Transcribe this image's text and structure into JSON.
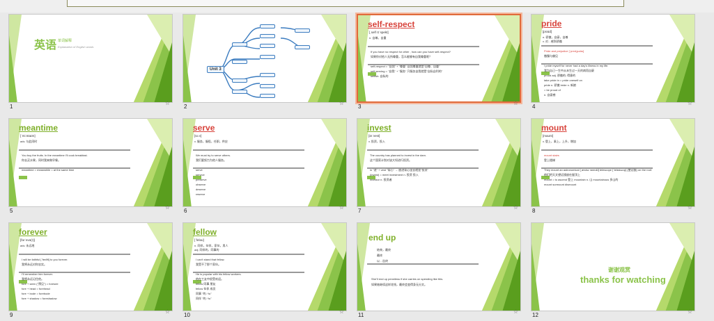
{
  "slides": [
    {
      "num": "1",
      "cover": {
        "title": "英语",
        "sub": "单词解释",
        "sub2": "Explanation of English words"
      }
    },
    {
      "num": "2",
      "mindmap": {
        "center": "Unit 3"
      }
    },
    {
      "num": "3",
      "title": "self-respect",
      "phon": "[ˌself rɪˈspekt]",
      "def": "n. 自尊，自重",
      "lines": [
        "If you have no respect for other , how can you have self-respect?",
        "如果你对他人无所尊重，怎么能够有自我尊重呢？",
        "self-respect  =  \"自我\" + \"尊重\"  自我尊重就是\"自尊、自重\"",
        "self-serving  =  \"自我\" + \"服务\"  只服务自我就是\"自私自利的\"",
        "selfish: 自私的"
      ]
    },
    {
      "num": "4",
      "title": "pride",
      "phon": "[praɪd]",
      "def": "n. 骄傲，自豪，自尊",
      "def2": "v. 对…感到骄傲",
      "lines": [
        "Pride and prejudice [ˈpredʒudɪs]",
        "傲慢与偏见",
        "I pride myself for never had a day's illness in my life.",
        "我为自己一生中从未生过一天的病而自豪",
        "proud   adj. 骄傲的; 得意的",
        "take pride in = pride oneself on",
        "pride   n. 骄傲   bride  n. 新娘",
        "= be proud of",
        "n. 自豪感"
      ]
    },
    {
      "num": "5",
      "title": "meantime",
      "phon": "[ˈmiːntaɪm]",
      "def": "adv. 与此同时",
      "lines": [
        "You buy the fruits. In the meantime I'll cook breakfast.",
        "你去买水果，同时我来做早餐。",
        "meantime = meanwhile = at the same time"
      ]
    },
    {
      "num": "6",
      "title": "serve",
      "phon": "[sɜːv]",
      "def": "v. 服务，服役，任职，供应",
      "lines": [
        "We must try to serve others.",
        "我们要努力为他人服务。",
        "serve",
        "service",
        "preserve",
        "observe",
        "deserve",
        "reserve"
      ]
    },
    {
      "num": "7",
      "title": "invest",
      "phon": "[ɪnˈvest]",
      "def": "v. 投资，投入",
      "lines": [
        "The country has planned to invest in the dam.",
        "这个国家计划对该大坝进行投资。",
        "in \"进\" + vest \"背心\" → 放进背心里去就是\"投资\"",
        "(Invest) = meet   investment n. 投资 投入",
        "investor n. 投资者"
      ]
    },
    {
      "num": "8",
      "title": "mount",
      "phon": "[maʊnt]",
      "def": "v. 登上，乘上，上升，增加",
      "lines": [
        "mount stairs",
        "登上楼梯",
        "They mount an astronomical [ˌæstrəˈnɒmɪkl] telescope [ˈtelɪskəʊp] (望远镜) on the roof.",
        "他们把天文望远镜放在屋顶上",
        "mount = to ascend 登上  mountain n. 山  mountainous 多山的",
        "mount  surmount  dismount"
      ]
    },
    {
      "num": "9",
      "title": "forever",
      "phon": "[fərˈevə(r)]",
      "def": "adv. 永远地",
      "lines": [
        "I will be faithful [ˈfeɪθfl] to you forever.",
        "我将永远对你忠实。",
        "I'll remember him forever.",
        "我将永远记住他。",
        "fore + seen (\"预见\") = foresee",
        "fore + head = forehead",
        "fore + bode = forebode",
        "fore + shadow = foreshadow"
      ]
    },
    {
      "num": "10",
      "title": "fellow",
      "phon": "[ˈfeləʊ]",
      "def": "n. 同伴，伙伴，家伙，男人",
      "def2": "adj. 同伴的，同事的",
      "lines": [
        "I can't stand that fellow.",
        "我受不了那个家伙。",
        "He is popular with his fellow workers.",
        "他在工友中很受欢迎。",
        "fellow 同事 朋友",
        "fellow 伙伴 成员",
        "同事 \"的 / fu\"",
        "同伴 \"的 / fu\""
      ]
    },
    {
      "num": "11",
      "title": "end up",
      "def": "结束，最终",
      "lines": [
        "最终",
        "以…告终",
        "She'll end up penniless if she carries on spending like this.",
        "如果她继续这样花钱，最终会变得身无分文。"
      ]
    },
    {
      "num": "12",
      "thanks": {
        "cn": "谢谢观赏",
        "en": "thanks for watching"
      }
    }
  ],
  "colors": {
    "green": "#8bc34a",
    "dark_green": "#5a9e1e",
    "accent": "#d8433b",
    "selected": "#e06a3a"
  }
}
